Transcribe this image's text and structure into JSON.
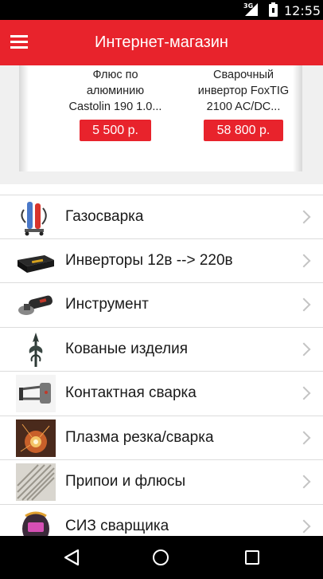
{
  "status_bar": {
    "network": "3G",
    "time": "12:55"
  },
  "app_bar": {
    "title": "Интернет-магазин",
    "menu_icon": "hamburger-menu-icon"
  },
  "featured_products": [
    {
      "name": "Флюс по\nалюминию\nCastolin 190 1.0...",
      "price": "5 500 р."
    },
    {
      "name": "Сварочный\nинвертор FoxTIG\n2100 AC/DC...",
      "price": "58 800 р."
    }
  ],
  "categories": [
    {
      "label": "Газосварка",
      "icon": "gas-welding-thumbnail"
    },
    {
      "label": "Инверторы 12в --> 220в",
      "icon": "inverter-thumbnail"
    },
    {
      "label": "Инструмент",
      "icon": "angle-grinder-thumbnail"
    },
    {
      "label": "Кованые изделия",
      "icon": "forged-item-thumbnail"
    },
    {
      "label": "Контактная сварка",
      "icon": "spot-welder-thumbnail"
    },
    {
      "label": "Плазма резка/сварка",
      "icon": "plasma-cutting-thumbnail"
    },
    {
      "label": "Припои и флюсы",
      "icon": "solder-rods-thumbnail"
    },
    {
      "label": "СИЗ сварщика",
      "icon": "welding-helmet-thumbnail"
    }
  ],
  "colors": {
    "accent": "#e8232c",
    "divider": "#dcdcdc",
    "chevron": "#c4c4c4"
  }
}
